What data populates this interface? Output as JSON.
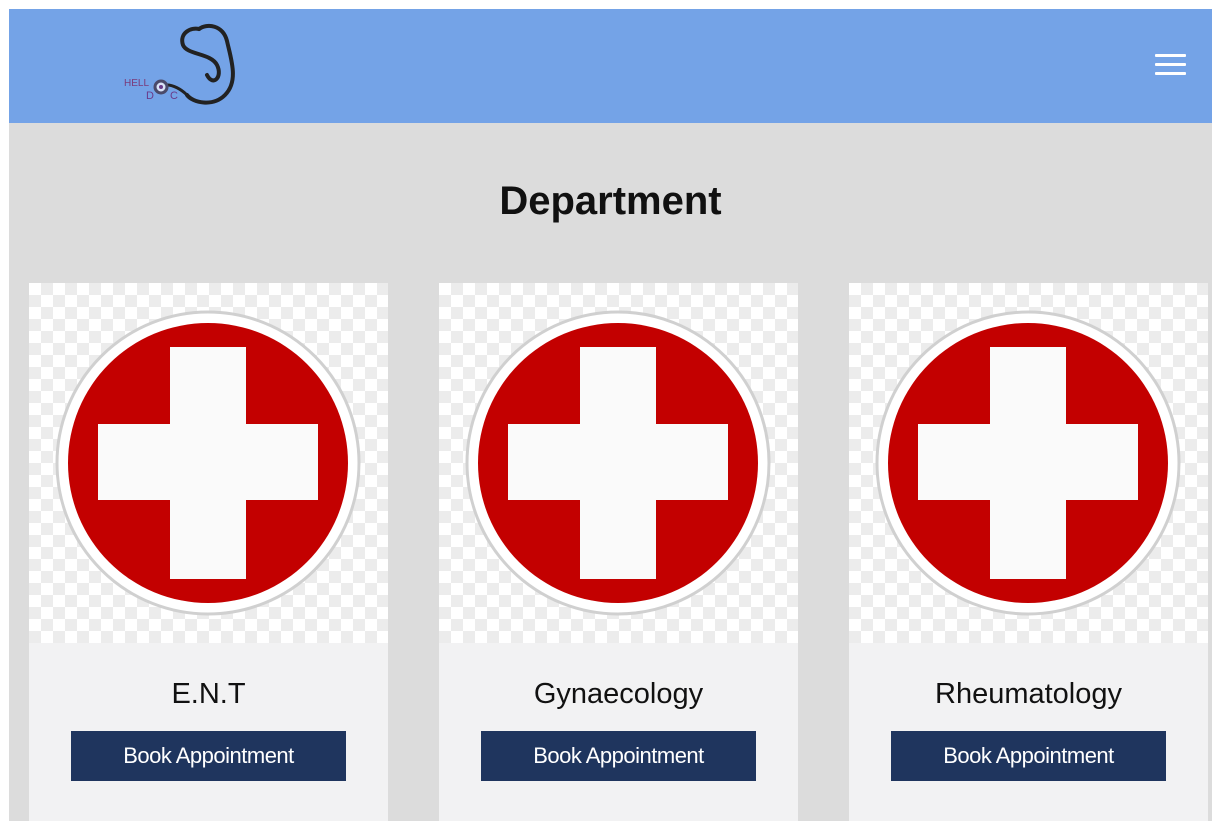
{
  "header": {
    "logo_text_top": "HELL",
    "logo_text_bottom": "D",
    "logo_text_end": "C",
    "menu_icon": "hamburger-menu-icon",
    "background_color": "#74a3e7"
  },
  "page": {
    "heading": "Department"
  },
  "departments": [
    {
      "name": "E.N.T",
      "button_label": "Book Appointment",
      "icon": "medical-cross-icon"
    },
    {
      "name": "Gynaecology",
      "button_label": "Book Appointment",
      "icon": "medical-cross-icon"
    },
    {
      "name": "Rheumatology",
      "button_label": "Book Appointment",
      "icon": "medical-cross-icon"
    }
  ],
  "colors": {
    "cross_red": "#c30000",
    "button_navy": "#1f355e",
    "page_bg": "#dcdcdc"
  }
}
